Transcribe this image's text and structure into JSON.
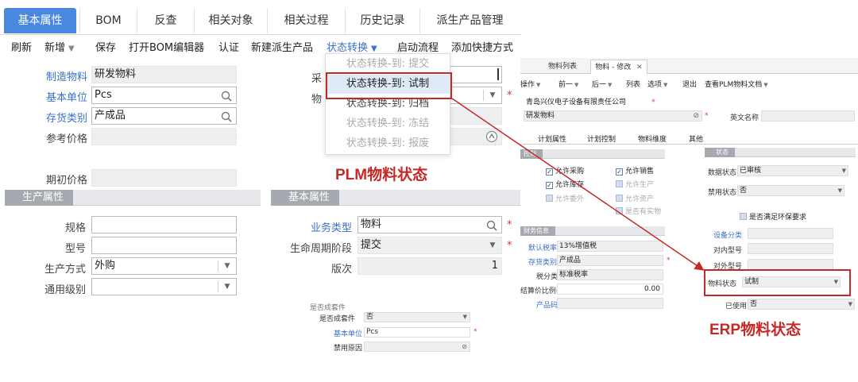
{
  "plm": {
    "tabs": [
      "基本属性",
      "BOM",
      "反查",
      "相关对象",
      "相关过程",
      "历史记录",
      "派生产品管理"
    ],
    "toolbar": {
      "refresh": "刷新",
      "new": "新增",
      "save": "保存",
      "open_bom": "打开BOM编辑器",
      "certify": "认证",
      "new_derived": "新建派生产品",
      "state_transition": "状态转换",
      "start_flow": "启动流程",
      "add_shortcut": "添加快捷方式"
    },
    "fields": {
      "make_material_label": "制造物料",
      "make_material_value": "研发物料",
      "base_unit_label": "基本单位",
      "base_unit_value": "Pcs",
      "stock_type_label": "存货类别",
      "stock_type_value": "产成品",
      "ref_price_label": "参考价格",
      "init_price_label": "期初价格",
      "caigou_label": "采",
      "wu_label": "物"
    },
    "production_section": "生产属性",
    "production": {
      "spec_label": "规格",
      "model_label": "型号",
      "method_label": "生产方式",
      "method_value": "外购",
      "level_label": "通用级别"
    },
    "basic_section": "基本属性",
    "basic": {
      "biz_type_label": "业务类型",
      "biz_type_value": "物料",
      "lifecycle_label": "生命周期阶段",
      "lifecycle_value": "提交",
      "version_label": "版次",
      "version_value": "1"
    },
    "state_menu": [
      "状态转换-到: 提交",
      "状态转换-到: 试制",
      "状态转换-到: 归档",
      "状态转换-到: 冻结",
      "状态转换-到: 报废"
    ],
    "caption": "PLM物料状态"
  },
  "fragment": {
    "row1_label": "是否成套件",
    "row1_value": "否",
    "row2_label": "基本单位",
    "row2_value": "Pcs",
    "row3_label": "禁用原因"
  },
  "erp": {
    "tabs": [
      "物料列表",
      "物料 - 修改"
    ],
    "menu": [
      "操作",
      "前一",
      "后一",
      "列表",
      "选项",
      "退出",
      "查看PLM物料文档"
    ],
    "company": "青岛兴仪电子设备有限责任公司",
    "material": "研发物料",
    "english_name_label": "英文名称",
    "subtabs": [
      "计划属性",
      "计划控制",
      "物料维度",
      "其他"
    ],
    "control_section": "控制",
    "status_section": "状态",
    "checks": {
      "allow_purchase": "允许采购",
      "allow_sale": "允许销售",
      "allow_stock": "允许库存",
      "allow_produce": "允许生产",
      "allow_outsource": "允许委外",
      "allow_asset": "允许资产",
      "is_physical": "是否有实物",
      "is_env": "是否满足环保要求"
    },
    "data_status_label": "数据状态",
    "data_status_value": "已审核",
    "disable_status_label": "禁用状态",
    "disable_status_value": "否",
    "finance_section": "财务信息",
    "tax_rate_label": "默认税率",
    "tax_rate_value": "13%增值税",
    "stock_type_label": "存货类别",
    "stock_type_value": "产成品",
    "tax_class_label": "税分类",
    "tax_class_value": "标准税率",
    "ratio_label": "结算价比例(%)",
    "ratio_value": "0.00",
    "product_code_label": "产品码",
    "device_class_label": "设备分类",
    "internal_model_label": "对内型号",
    "external_model_label": "对外型号",
    "material_status_label": "物料状态",
    "material_status_value": "试制",
    "used_label": "已使用",
    "used_value": "否",
    "caption": "ERP物料状态"
  },
  "colors": {
    "accent": "#4a88e0",
    "annotation": "#c62828",
    "link": "#3a70c7"
  }
}
